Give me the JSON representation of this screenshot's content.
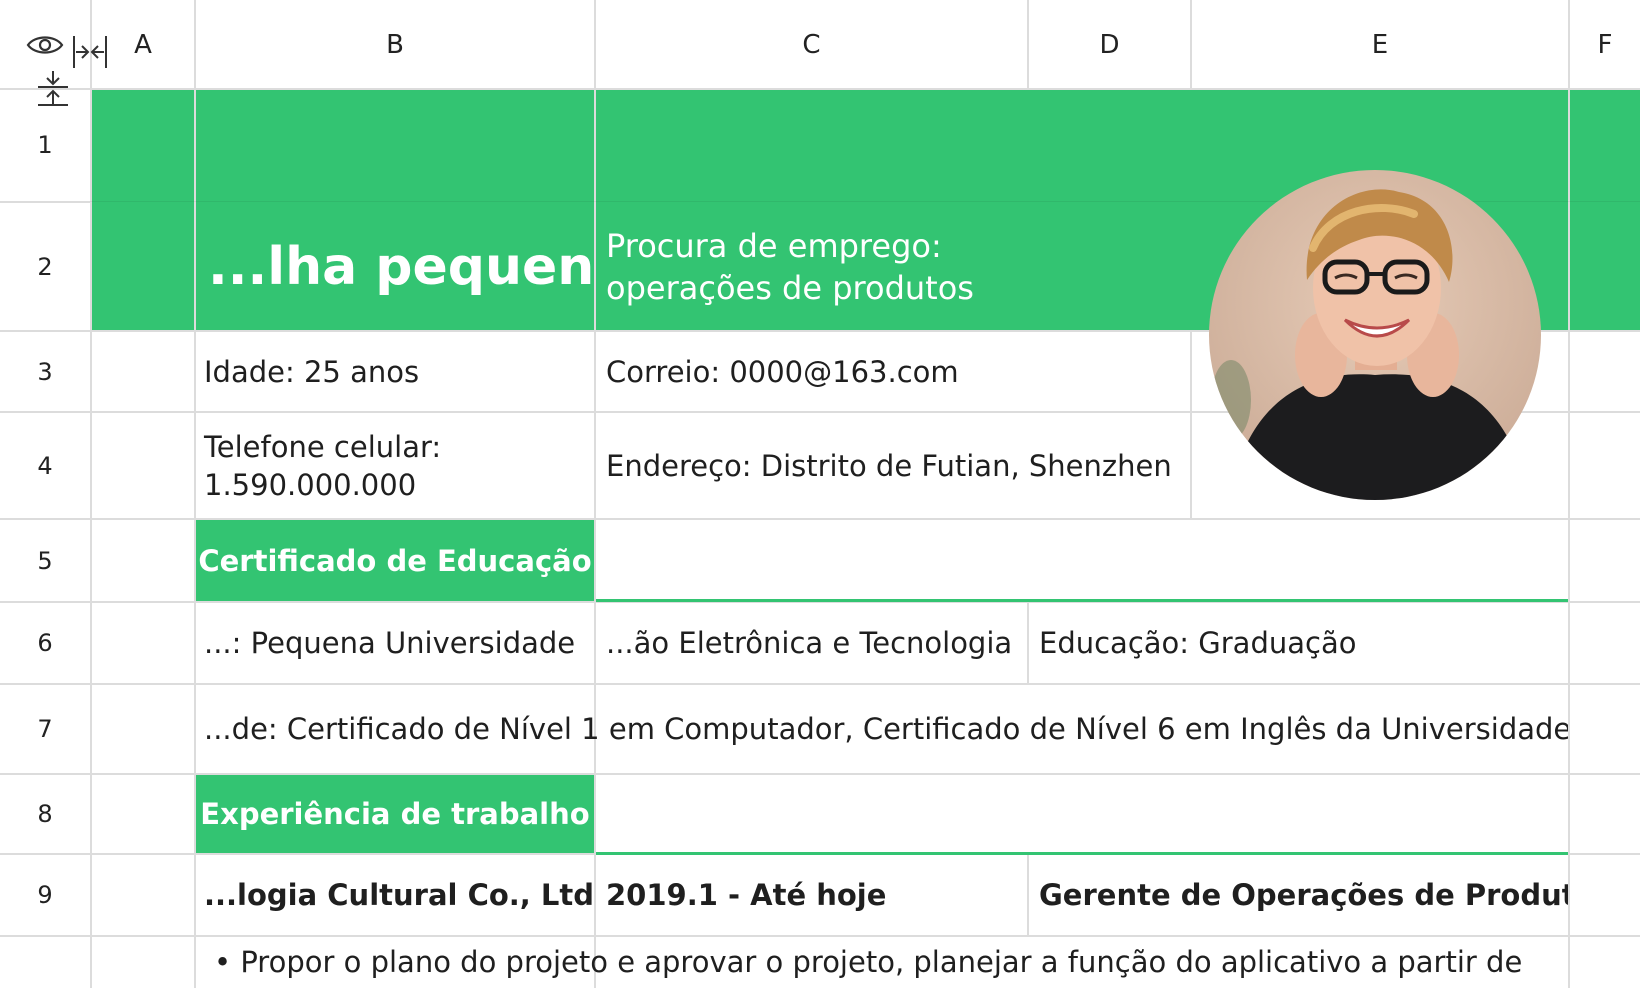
{
  "app": {
    "toolbar_icons": [
      "eye-icon",
      "collapse-columns-icon",
      "collapse-rows-icon"
    ]
  },
  "columns": [
    "A",
    "B",
    "C",
    "D",
    "E",
    "F"
  ],
  "rows": [
    "1",
    "2",
    "3",
    "4",
    "5",
    "6",
    "7",
    "8",
    "9"
  ],
  "resume": {
    "name": "...lha pequena",
    "job_target": "Procura de emprego: operações de produtos",
    "age": "Idade: 25 anos",
    "email": "Correio: 0000@163.com",
    "phone": "Telefone celular: 1.590.000.000",
    "address": "Endereço: Distrito de Futian, Shenzhen",
    "photo": "profile-photo"
  },
  "education": {
    "section_title": "Certificado de Educação",
    "school": "...: Pequena Universidade",
    "major": "...ão Eletrônica e Tecnologia",
    "degree": "Educação: Graduação",
    "certificates": "...de: Certificado de Nível 1 em Computador, Certificado de Nível 6 em Inglês da Universidade"
  },
  "work": {
    "section_title": "Experiência de trabalho",
    "company": "...logia Cultural Co., Ltd.",
    "period": "2019.1 - Até hoje",
    "position": "Gerente de Operações de Produto",
    "bullet": "• Propor o plano do projeto e aprovar o projeto, planejar a função do aplicativo a partir de"
  },
  "colors": {
    "accent": "#33c472",
    "grid": "#dcdcdc",
    "text": "#1f1f1f",
    "header_text": "#ffffff"
  }
}
